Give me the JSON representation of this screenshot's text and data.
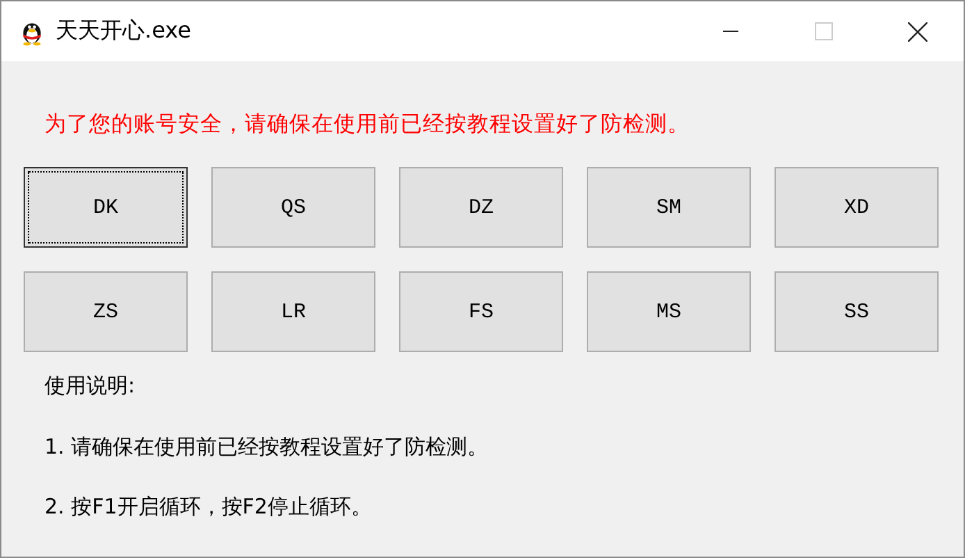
{
  "window": {
    "title": "天天开心.exe"
  },
  "notice": "为了您的账号安全，请确保在使用前已经按教程设置好了防检测。",
  "buttons": [
    {
      "label": "DK",
      "focused": true
    },
    {
      "label": "QS",
      "focused": false
    },
    {
      "label": "DZ",
      "focused": false
    },
    {
      "label": "SM",
      "focused": false
    },
    {
      "label": "XD",
      "focused": false
    },
    {
      "label": "ZS",
      "focused": false
    },
    {
      "label": "LR",
      "focused": false
    },
    {
      "label": "FS",
      "focused": false
    },
    {
      "label": "MS",
      "focused": false
    },
    {
      "label": "SS",
      "focused": false
    }
  ],
  "instructions": {
    "heading": "使用说明:",
    "items": [
      "1. 请确保在使用前已经按教程设置好了防检测。",
      "2. 按F1开启循环，按F2停止循环。"
    ]
  }
}
